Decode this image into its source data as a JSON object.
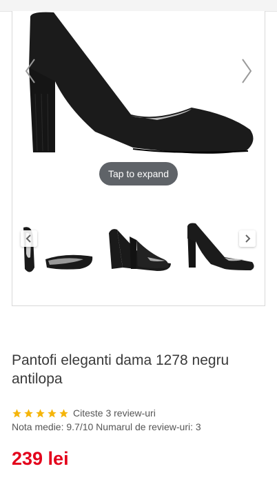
{
  "gallery": {
    "expand_label": "Tap to expand",
    "main_image": "black-suede-pump-side-view",
    "thumbnails": [
      {
        "name": "thumb-top-and-sole-view"
      },
      {
        "name": "thumb-front-angle-view"
      },
      {
        "name": "thumb-side-view"
      }
    ]
  },
  "product": {
    "title": "Pantofi eleganti dama 1278 negru antilopa",
    "rating_stars": 5,
    "review_link": "Citeste 3 review-uri",
    "meta": "Nota medie: 9.7/10 Numarul de review-uri: 3",
    "price": "239 lei"
  },
  "colors": {
    "price": "#e3001b",
    "star": "#f5b50a",
    "pill": "#5f6368"
  }
}
